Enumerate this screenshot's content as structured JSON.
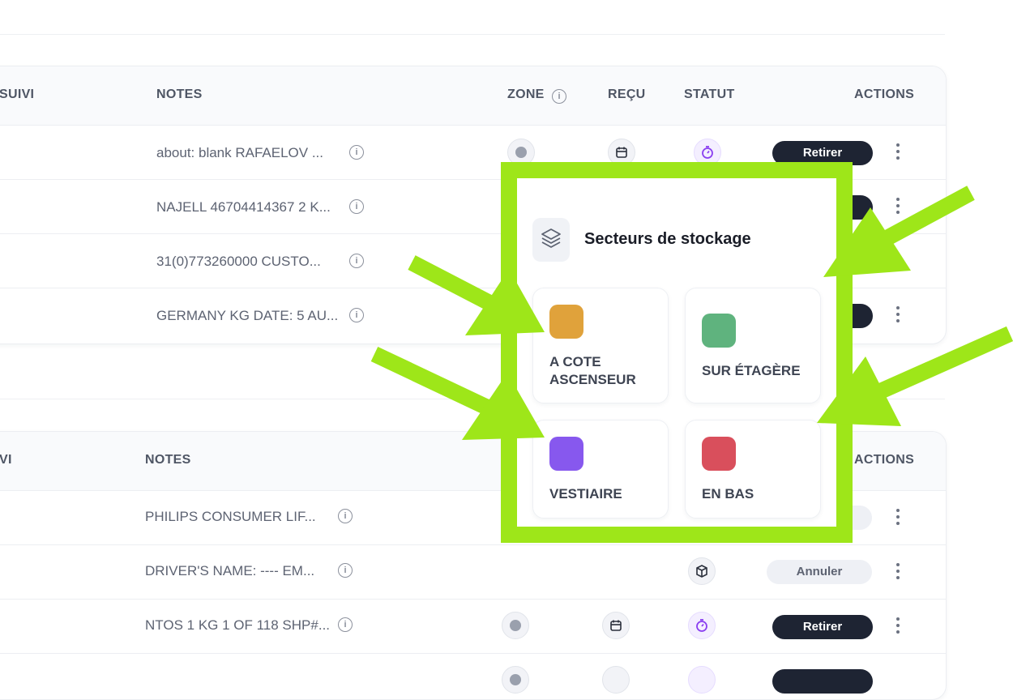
{
  "table1": {
    "headers": {
      "suivi": "SUIVI",
      "notes": "NOTES",
      "zone": "ZONE",
      "recu": "REÇU",
      "statut": "STATUT",
      "actions": "ACTIONS"
    },
    "rows": [
      {
        "note": "about: blank RAFAELOV ...",
        "action": "Retirer"
      },
      {
        "note": "NAJELL 46704414367 2 K..."
      },
      {
        "note": "31(0)773260000 CUSTO..."
      },
      {
        "note": "GERMANY KG DATE: 5 AU..."
      }
    ]
  },
  "table2": {
    "headers": {
      "suivi": "VI",
      "notes": "NOTES",
      "actions": "ACTIONS"
    },
    "rows": [
      {
        "note": "PHILIPS CONSUMER LIF..."
      },
      {
        "note": "DRIVER'S NAME: ---- EM...",
        "action": "Annuler"
      },
      {
        "note": "NTOS 1 KG 1 OF 118 SHP#...",
        "action": "Retirer"
      }
    ]
  },
  "popup": {
    "title": "Secteurs de stockage",
    "sectors": [
      {
        "label": "A COTE ASCENSEUR",
        "color": "#e0a23b"
      },
      {
        "label": "SUR ÉTAGÈRE",
        "color": "#5fb37e"
      },
      {
        "label": "VESTIAIRE",
        "color": "#8758ee"
      },
      {
        "label": "EN BAS",
        "color": "#d94f5c"
      }
    ]
  },
  "annotation_color": "#9ee619"
}
